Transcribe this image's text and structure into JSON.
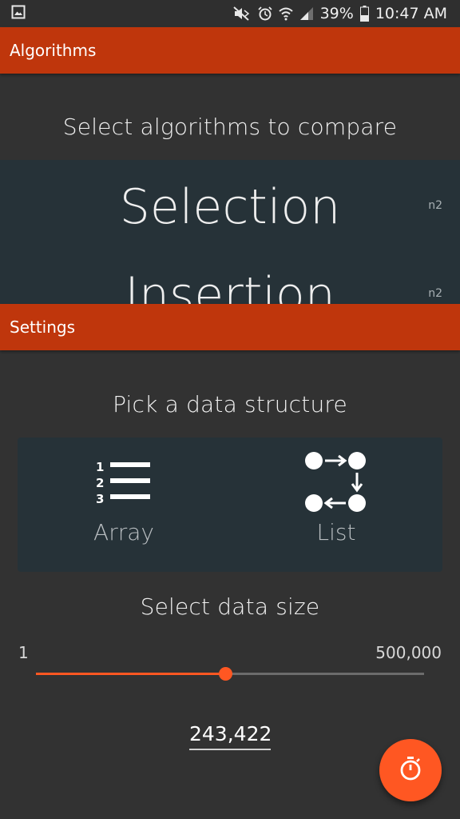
{
  "status_bar": {
    "battery": "39%",
    "time": "10:47 AM",
    "icons": [
      "gallery-icon",
      "mute-icon",
      "alarm-icon",
      "wifi-icon",
      "signal-icon",
      "battery-icon"
    ]
  },
  "algorithms_bar": {
    "title": "Algorithms"
  },
  "algorithms": {
    "heading": "Select algorithms to compare",
    "items": [
      {
        "name": "Selection",
        "complexity": "n2"
      },
      {
        "name": "Insertion",
        "complexity": "n2"
      }
    ]
  },
  "settings_bar": {
    "title": "Settings"
  },
  "settings": {
    "data_structure_heading": "Pick a data structure",
    "options": [
      {
        "label": "Array",
        "icon": "array-list-icon"
      },
      {
        "label": "List",
        "icon": "linked-list-icon"
      }
    ],
    "data_size_heading": "Select data size",
    "slider": {
      "min_label": "1",
      "max_label": "500,000",
      "min": 1,
      "max": 500000,
      "value": 243422
    },
    "size_value": "243,422"
  },
  "fab": {
    "icon": "stopwatch-icon"
  },
  "colors": {
    "background": "#323232",
    "app_bar": "#bf360c",
    "card": "#263238",
    "accent": "#ff5722"
  }
}
